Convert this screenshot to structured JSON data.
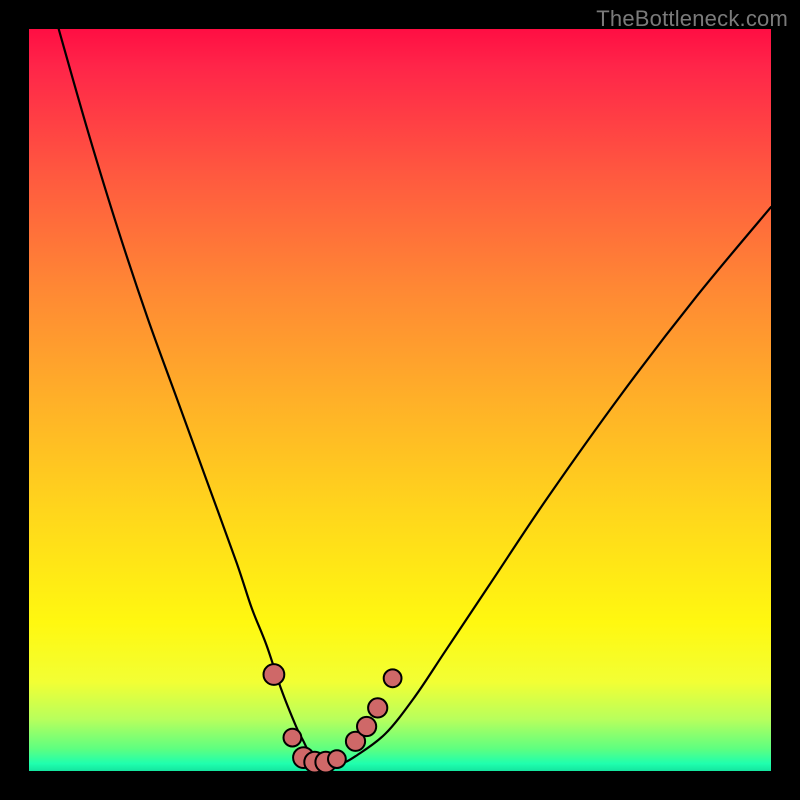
{
  "watermark": "TheBottleneck.com",
  "colors": {
    "page_bg": "#000000",
    "gradient_top": "#ff0e43",
    "gradient_bottom": "#14e59f",
    "curve": "#000000",
    "marker_fill": "#cf6868",
    "watermark_text": "#7a7a7a"
  },
  "chart_data": {
    "type": "line",
    "title": "",
    "xlabel": "",
    "ylabel": "",
    "xlim": [
      0,
      100
    ],
    "ylim": [
      0,
      100
    ],
    "grid": false,
    "legend": false,
    "series": [
      {
        "name": "bottleneck-curve",
        "x": [
          4,
          8,
          12,
          16,
          20,
          24,
          28,
          30,
          32,
          34,
          36,
          37,
          38,
          39,
          40,
          42,
          44,
          48,
          52,
          56,
          62,
          70,
          80,
          90,
          100
        ],
        "y": [
          100,
          86,
          73,
          61,
          50,
          39,
          28,
          22,
          17,
          11,
          6,
          4,
          2,
          1,
          1,
          1,
          2,
          5,
          10,
          16,
          25,
          37,
          51,
          64,
          76
        ]
      }
    ],
    "minimum_x": 39,
    "markers": [
      {
        "name": "left-upper",
        "x": 33.0,
        "y": 13.0,
        "r": 1.4
      },
      {
        "name": "left-mid",
        "x": 35.5,
        "y": 4.5,
        "r": 1.2
      },
      {
        "name": "valley-1",
        "x": 37.0,
        "y": 1.8,
        "r": 1.4
      },
      {
        "name": "valley-2",
        "x": 38.5,
        "y": 1.2,
        "r": 1.4
      },
      {
        "name": "valley-3",
        "x": 40.0,
        "y": 1.2,
        "r": 1.4
      },
      {
        "name": "valley-4",
        "x": 41.5,
        "y": 1.6,
        "r": 1.2
      },
      {
        "name": "right-1",
        "x": 44.0,
        "y": 4.0,
        "r": 1.3
      },
      {
        "name": "right-2",
        "x": 45.5,
        "y": 6.0,
        "r": 1.3
      },
      {
        "name": "right-3",
        "x": 47.0,
        "y": 8.5,
        "r": 1.3
      },
      {
        "name": "right-upper",
        "x": 49.0,
        "y": 12.5,
        "r": 1.2
      }
    ]
  }
}
